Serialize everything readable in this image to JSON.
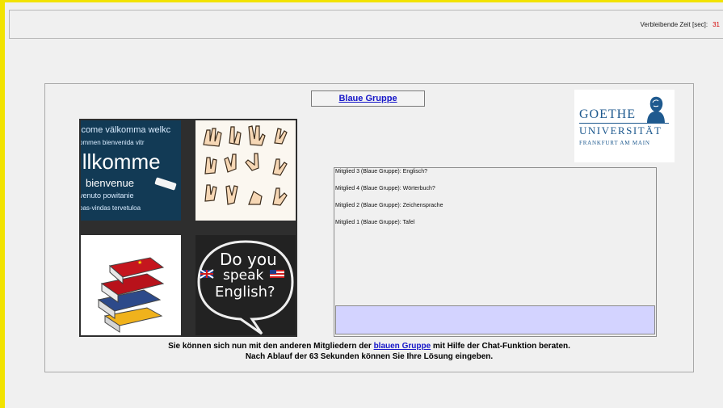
{
  "timer": {
    "label": "Verbleibende Zeit [sec]:",
    "value": "31"
  },
  "group": {
    "name": "Blaue Gruppe"
  },
  "logo": {
    "line1": "GOETHE",
    "line2": "UNIVERSITÄT",
    "line3": "FRANKFURT AM MAIN"
  },
  "images": {
    "welcome": {
      "w1": "lcome välkomma welkc",
      "w2": "ommen bienvenida vitr",
      "w3": "illkomme",
      "w4": "bienvenue",
      "w5": "venuto powitanie",
      "w6": "oas-vindas tervetuloa"
    },
    "speech": {
      "line1": "Do you",
      "line2": "speak",
      "line3": "English?"
    }
  },
  "chat": {
    "messages": [
      "Mitglied 3 (Blaue Gruppe): Englisch?",
      "Mitglied 4 (Blaue Gruppe): Wörterbuch?",
      "Mitglied 2 (Blaue Gruppe): Zeichensprache",
      "Mitglied 1 (Blaue Gruppe): Tafel"
    ],
    "input_value": ""
  },
  "instructions": {
    "line1_before": "Sie können sich nun mit den anderen Mitgliedern der ",
    "line1_link": "blauen Gruppe",
    "line1_after": " mit Hilfe der Chat-Funktion beraten.",
    "line2": "Nach Ablauf der 63 Sekunden können Sie Ihre Lösung eingeben."
  }
}
